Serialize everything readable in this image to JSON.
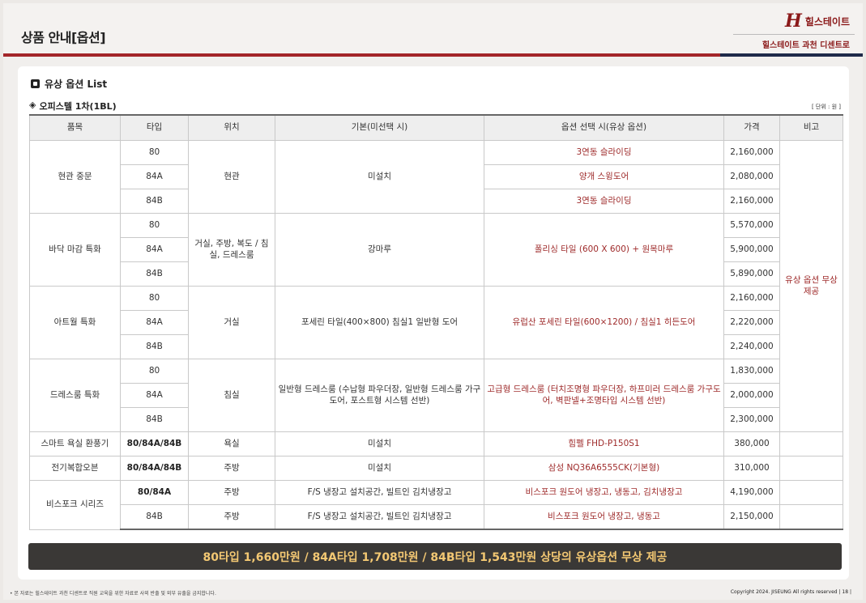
{
  "header": {
    "title": "상품 안내[옵션]",
    "logo_mark": "H",
    "logo_text": "힐스테이트",
    "project": "힐스테이트 과천 디센트로"
  },
  "section": {
    "title": "유상 옵션 List",
    "subtitle_prefix": "◈",
    "subtitle": "오피스텔 1차(1BL)",
    "unit": "[ 단위 : 원 ]"
  },
  "table": {
    "headers": [
      "품목",
      "타입",
      "위치",
      "기본(미선택 시)",
      "옵션 선택 시(유상 옵션)",
      "가격",
      "비고"
    ],
    "groups": [
      {
        "item": "현관 중문",
        "location": "현관",
        "basic": "미설치",
        "rows": [
          {
            "type": "80",
            "option": "3연동 슬라이딩",
            "price": "2,160,000"
          },
          {
            "type": "84A",
            "option": "양개 스윙도어",
            "price": "2,080,000"
          },
          {
            "type": "84B",
            "option": "3연동 슬라이딩",
            "price": "2,160,000"
          }
        ]
      },
      {
        "item": "바닥 마감 특화",
        "location": "거실, 주방, 복도 / 침실, 드레스룸",
        "basic": "강마루",
        "option": "폴리싱 타일 (600 X 600) + 원목마루",
        "rows": [
          {
            "type": "80",
            "price": "5,570,000"
          },
          {
            "type": "84A",
            "price": "5,900,000"
          },
          {
            "type": "84B",
            "price": "5,890,000"
          }
        ]
      },
      {
        "item": "아트월 특화",
        "location": "거실",
        "basic": "포세린 타일(400×800) 침실1 일반형 도어",
        "option": "유럽산 포세린 타일(600×1200) / 침실1 히든도어",
        "rows": [
          {
            "type": "80",
            "price": "2,160,000"
          },
          {
            "type": "84A",
            "price": "2,220,000"
          },
          {
            "type": "84B",
            "price": "2,240,000"
          }
        ]
      },
      {
        "item": "드레스룸 특화",
        "location": "침실",
        "basic": "일반형 드레스룸 (수납형 파우더장, 일반형 드레스룸 가구도어, 포스트형 시스템 선반)",
        "option": "고급형 드레스룸 (터치조명형 파우더장, 하프미러 드레스룸 가구도어, 벽판넬+조명타입 시스템 선반)",
        "rows": [
          {
            "type": "80",
            "price": "1,830,000"
          },
          {
            "type": "84A",
            "price": "2,000,000"
          },
          {
            "type": "84B",
            "price": "2,300,000"
          }
        ]
      }
    ],
    "single_rows": [
      {
        "item": "스마트 욕실 환풍기",
        "type": "80/84A/84B",
        "location": "욕실",
        "basic": "미설치",
        "option": "힘펠 FHD-P150S1",
        "price": "380,000"
      },
      {
        "item": "전기복합오븐",
        "type": "80/84A/84B",
        "location": "주방",
        "basic": "미설치",
        "option": "삼성 NQ36A6555CK(기본형)",
        "price": "310,000"
      }
    ],
    "bespoke": {
      "item": "비스포크 시리즈",
      "rows": [
        {
          "type": "80/84A",
          "location": "주방",
          "basic": "F/S 냉장고 설치공간, 빌트인 김치냉장고",
          "option": "비스포크 원도어 냉장고, 냉동고, 김치냉장고",
          "price": "4,190,000"
        },
        {
          "type": "84B",
          "location": "주방",
          "basic": "F/S 냉장고 설치공간, 빌트인 김치냉장고",
          "option": "비스포크 원도어 냉장고, 냉동고",
          "price": "2,150,000"
        }
      ]
    },
    "note": "유상 옵션 무상 제공"
  },
  "banner": "80타입 1,660만원 / 84A타입 1,708만원 / 84B타입 1,543만원 상당의 유상옵션 무상 제공",
  "footer": {
    "left": "• 본 자료는 힐스테이트 과천 디센트로 직원 교육을 위한 자료로 사외 반출 및 외부 유출을 금지합니다.",
    "copyright": "Copyright 2024. JISEUNG All rights reserved",
    "page": "| 18 |"
  },
  "colors": {
    "accent_red": "#a3262a",
    "accent_navy": "#1f2a4a",
    "option_text": "#9e2a2a",
    "banner_bg": "#3a3836",
    "banner_text": "#f3c873"
  }
}
